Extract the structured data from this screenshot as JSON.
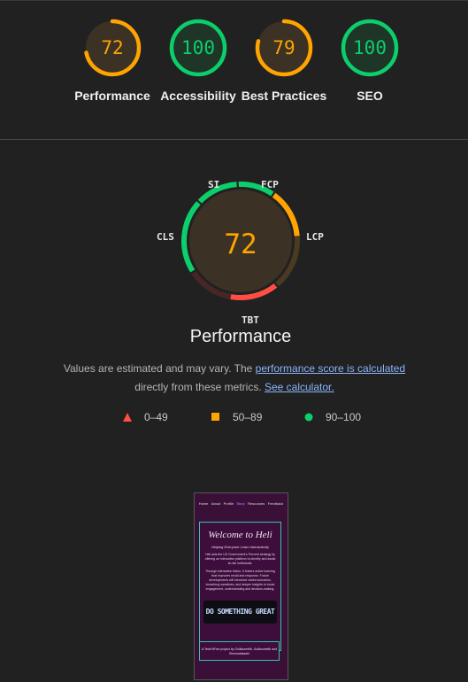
{
  "summary": {
    "categories": [
      {
        "label": "Performance",
        "score": "72",
        "fraction": 0.72,
        "color": "#ffa400"
      },
      {
        "label": "Accessibility",
        "score": "100",
        "fraction": 1.0,
        "color": "#0cce6b"
      },
      {
        "label": "Best Practices",
        "score": "79",
        "fraction": 0.79,
        "color": "#ffa400"
      },
      {
        "label": "SEO",
        "score": "100",
        "fraction": 1.0,
        "color": "#0cce6b"
      }
    ]
  },
  "performance": {
    "score": "72",
    "title": "Performance",
    "metrics": [
      "SI",
      "FCP",
      "LCP",
      "TBT",
      "CLS"
    ],
    "note_prefix": "Values are estimated and may vary. The ",
    "note_link1": "performance score is calculated",
    "note_middle": "directly from these metrics. ",
    "note_link2": "See calculator."
  },
  "legend": [
    {
      "range": "0–49",
      "shape": "triangle-icon",
      "color": "#ff4e42"
    },
    {
      "range": "50–89",
      "shape": "square-icon",
      "color": "#ffa400"
    },
    {
      "range": "90–100",
      "shape": "circle-icon",
      "color": "#0cce6b"
    }
  ],
  "thumbnail": {
    "nav": [
      "Home",
      "About",
      "Profile",
      "Story",
      "Resources",
      "Feedback"
    ],
    "heading": "Welcome to Heli",
    "subheading": "Helping Everyone Learn Interactively",
    "para1": "Heli aids the UK Government's Prevent strategy by offering an interactive platform to identify and assist at-risk individuals.",
    "para2": "Through interactive fiction, it fosters active learning that improves recall and response. Future developments will introduce varied scenarios, branching narratives, and deeper insights to boost engagement, understanding and decision-making.",
    "image_text": "DO SOMETHING GREAT",
    "footer": "A TechHiFive project by Guillaumefib, Guillaumefib and Simonatakashi"
  },
  "colors": {
    "good": "#0cce6b",
    "average": "#ffa400",
    "poor": "#ff4e42"
  }
}
